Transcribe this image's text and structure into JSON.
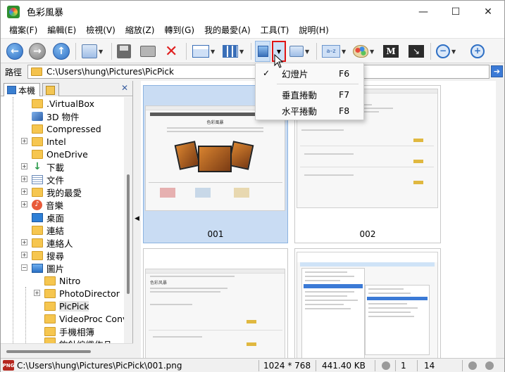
{
  "window": {
    "title": "色彩風暴",
    "minimize": "—",
    "maximize": "☐",
    "close": "✕"
  },
  "menu": [
    "檔案(F)",
    "編輯(E)",
    "檢視(V)",
    "縮放(Z)",
    "轉到(G)",
    "我的最愛(A)",
    "工具(T)",
    "說明(H)"
  ],
  "path": {
    "label": "路徑",
    "value": "C:\\Users\\hung\\Pictures\\PicPick"
  },
  "tabs": {
    "computer": "本機"
  },
  "tree": [
    {
      "label": ".VirtualBox",
      "icon": "folder-icon"
    },
    {
      "label": "3D 物件",
      "icon": "cube-icon"
    },
    {
      "label": "Compressed",
      "icon": "folder-icon"
    },
    {
      "label": "Intel",
      "icon": "folder-icon"
    },
    {
      "label": "OneDrive",
      "icon": "folder-icon"
    },
    {
      "label": "下載",
      "icon": "download-icon"
    },
    {
      "label": "文件",
      "icon": "document-icon"
    },
    {
      "label": "我的最愛",
      "icon": "folder-icon"
    },
    {
      "label": "音樂",
      "icon": "music-icon"
    },
    {
      "label": "桌面",
      "icon": "desktop-icon"
    },
    {
      "label": "連結",
      "icon": "folder-icon"
    },
    {
      "label": "連絡人",
      "icon": "folder-icon"
    },
    {
      "label": "搜尋",
      "icon": "folder-icon"
    },
    {
      "label": "圖片",
      "icon": "pictures-icon"
    },
    {
      "label": "Nitro",
      "icon": "folder-icon"
    },
    {
      "label": "PhotoDirector",
      "icon": "folder-icon"
    },
    {
      "label": "PicPick",
      "icon": "folder-icon"
    },
    {
      "label": "VideoProc Conv",
      "icon": "folder-icon"
    },
    {
      "label": "手機相簿",
      "icon": "folder-icon"
    },
    {
      "label": "鉤針編織作品",
      "icon": "folder-icon"
    }
  ],
  "thumbnails": [
    {
      "label": "001",
      "selected": true
    },
    {
      "label": "002",
      "selected": false
    },
    {
      "label": "",
      "selected": false
    },
    {
      "label": "",
      "selected": false
    }
  ],
  "thumb_text": {
    "site_title": "色彩風暴",
    "site_title_cn": "色彩风暴"
  },
  "popup": [
    {
      "label": "幻燈片",
      "key": "F6",
      "checked": true
    },
    {
      "label": "垂直捲動",
      "key": "F7",
      "checked": false
    },
    {
      "label": "水平捲動",
      "key": "F8",
      "checked": false
    }
  ],
  "status": {
    "file_icon": "PNG",
    "filepath": "C:\\Users\\hung\\Pictures\\PicPick\\001.png",
    "dimensions": "1024 * 768",
    "filesize": "441.40 KB",
    "index": "1",
    "total": "14"
  },
  "colors": {
    "selection": "#c9dcf3",
    "highlight_border": "#e01515",
    "accent_blue": "#2e6fc4"
  }
}
